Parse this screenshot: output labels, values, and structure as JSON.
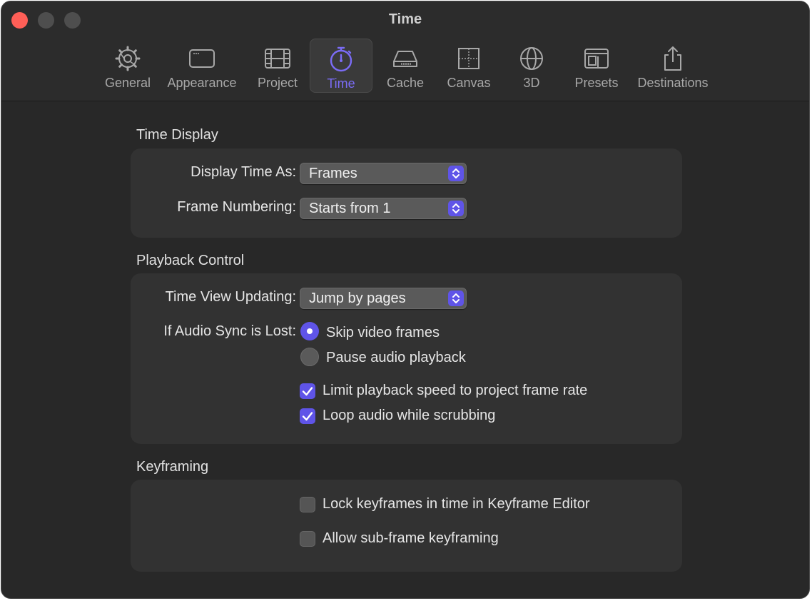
{
  "window": {
    "title": "Time"
  },
  "toolbar": {
    "items": [
      {
        "label": "General",
        "icon": "gear-icon"
      },
      {
        "label": "Appearance",
        "icon": "window-icon"
      },
      {
        "label": "Project",
        "icon": "film-icon"
      },
      {
        "label": "Time",
        "icon": "stopwatch-icon",
        "selected": true
      },
      {
        "label": "Cache",
        "icon": "drive-icon"
      },
      {
        "label": "Canvas",
        "icon": "canvas-icon"
      },
      {
        "label": "3D",
        "icon": "globe-icon"
      },
      {
        "label": "Presets",
        "icon": "presets-icon"
      },
      {
        "label": "Destinations",
        "icon": "share-icon"
      }
    ]
  },
  "time_display": {
    "title": "Time Display",
    "display_time_as": {
      "label": "Display Time As:",
      "value": "Frames"
    },
    "frame_numbering": {
      "label": "Frame Numbering:",
      "value": "Starts from 1"
    }
  },
  "playback_control": {
    "title": "Playback Control",
    "time_view_updating": {
      "label": "Time View Updating:",
      "value": "Jump by pages"
    },
    "audio_sync": {
      "label": "If Audio Sync is Lost:",
      "options": [
        {
          "label": "Skip video frames",
          "selected": true
        },
        {
          "label": "Pause audio playback",
          "selected": false
        }
      ]
    },
    "limit_playback": {
      "label": "Limit playback speed to project frame rate",
      "checked": true
    },
    "loop_audio": {
      "label": "Loop audio while scrubbing",
      "checked": true
    }
  },
  "keyframing": {
    "title": "Keyframing",
    "lock_keyframes": {
      "label": "Lock keyframes in time in Keyframe Editor",
      "checked": false
    },
    "sub_frame": {
      "label": "Allow sub-frame keyframing",
      "checked": false
    }
  },
  "colors": {
    "accent": "#5f54e8",
    "selected_tab": "#7b6cf6",
    "close": "#ff5f57"
  }
}
